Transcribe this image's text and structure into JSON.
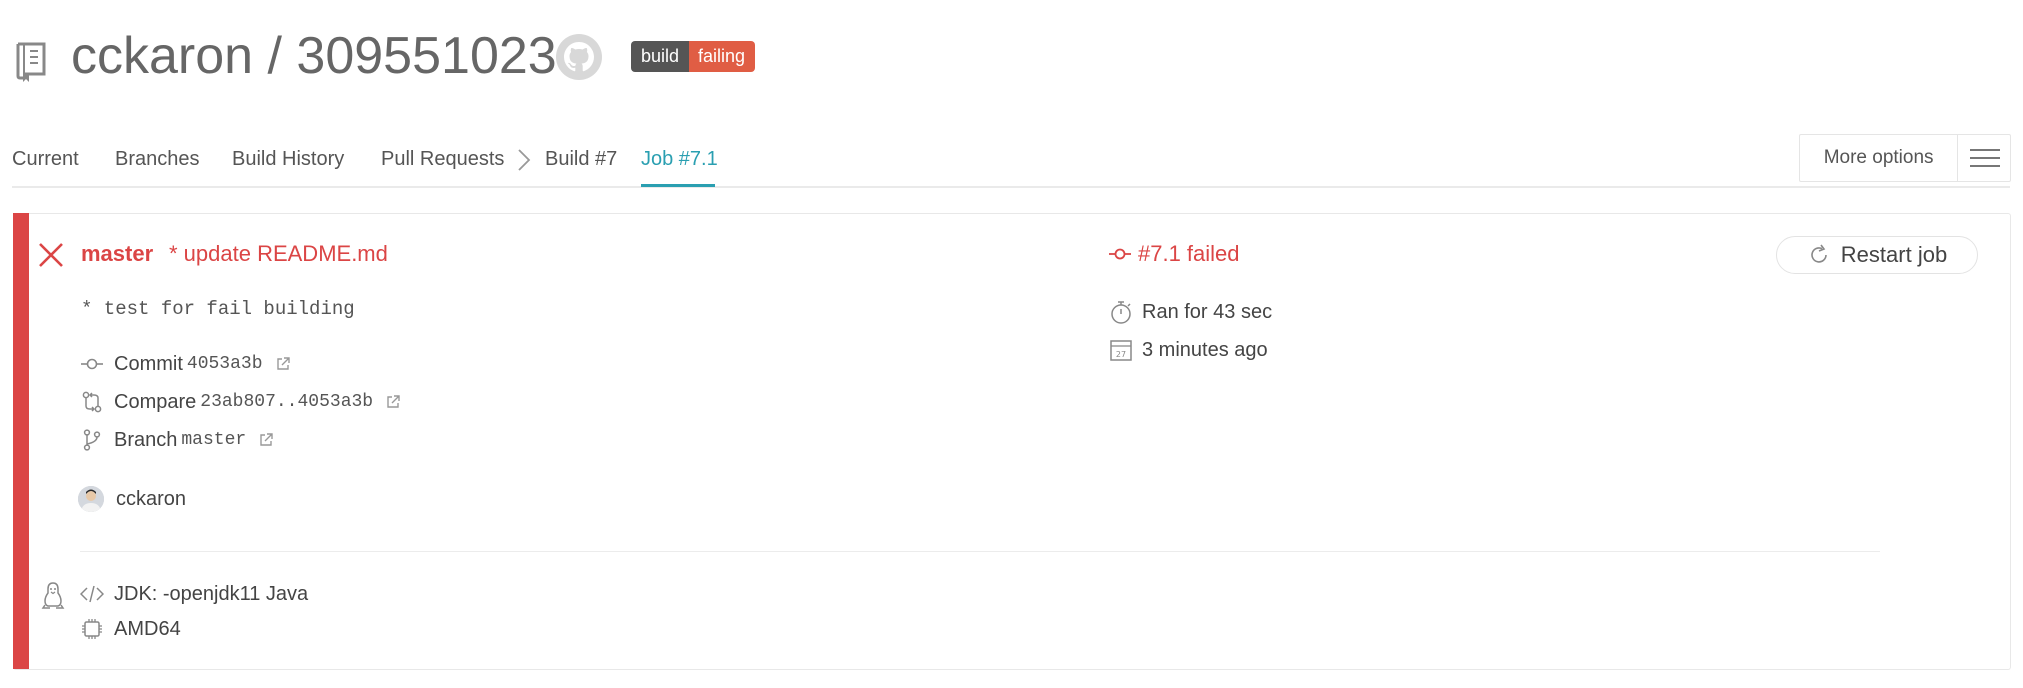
{
  "header": {
    "owner": "cckaron",
    "separator": " / ",
    "repo": "309551023",
    "badge": {
      "label": "build",
      "status": "failing",
      "label_color": "#555555",
      "status_color": "#e05d44"
    }
  },
  "tabs": {
    "current": "Current",
    "branches": "Branches",
    "build_history": "Build History",
    "pull_requests": "Pull Requests",
    "build": "Build #7",
    "job": "Job #7.1",
    "active_color": "#2a9fb1"
  },
  "more_options": {
    "label": "More options"
  },
  "job": {
    "state_color": "#db4545",
    "branch": "master",
    "commit_message": "* update README.md",
    "commit_body": "* test for fail building",
    "commit": {
      "label": "Commit",
      "value": "4053a3b"
    },
    "compare": {
      "label": "Compare",
      "value": "23ab807..4053a3b"
    },
    "branch_link": {
      "label": "Branch",
      "value": "master"
    },
    "author": "cckaron",
    "status": "#7.1 failed",
    "duration": "Ran for 43 sec",
    "finished": "3 minutes ago",
    "calendar_day": "27",
    "restart_label": "Restart job",
    "language": "JDK: -openjdk11 Java",
    "arch": "AMD64"
  }
}
